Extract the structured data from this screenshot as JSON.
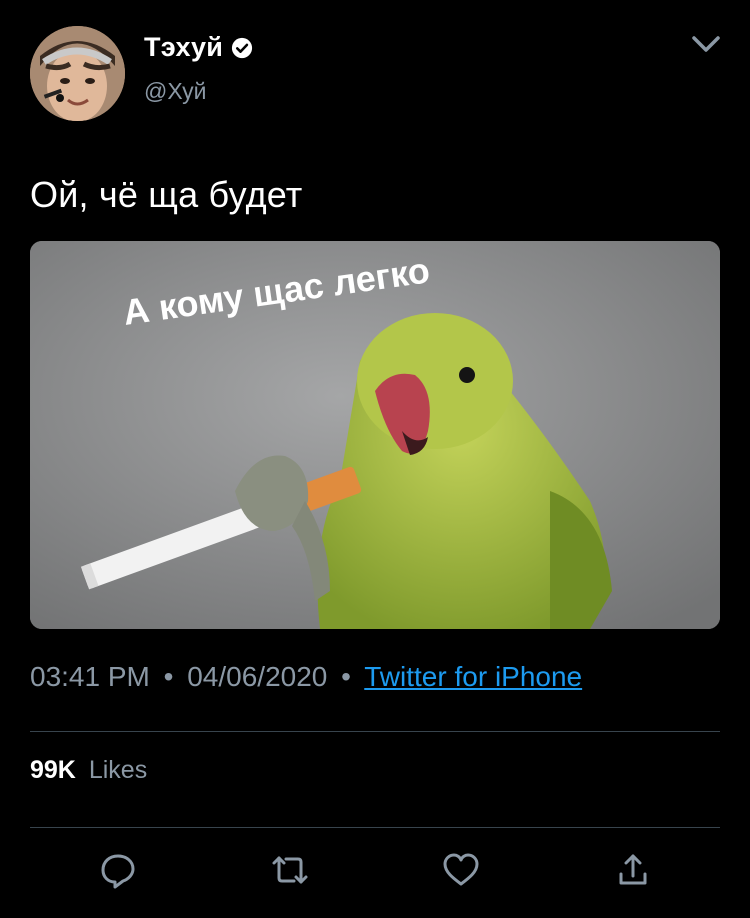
{
  "header": {
    "display_name": "Тэхуй",
    "handle": "@Хуй",
    "verified_icon": "verified-badge-icon",
    "menu_icon": "chevron-down-icon"
  },
  "tweet": {
    "text": "Ой, чё ща будет",
    "media": {
      "caption": "А кому щас легко"
    },
    "time": "03:41 PM",
    "separator": "•",
    "date": "04/06/2020",
    "source": "Twitter for iPhone"
  },
  "stats": {
    "likes_count": "99K",
    "likes_label": "Likes"
  },
  "actions": {
    "reply_icon": "reply-icon",
    "retweet_icon": "retweet-icon",
    "like_icon": "heart-icon",
    "share_icon": "share-icon"
  },
  "colors": {
    "background": "#000000",
    "secondary_text": "#8b98a5",
    "link": "#1d9bf0",
    "divider": "#38444d"
  }
}
